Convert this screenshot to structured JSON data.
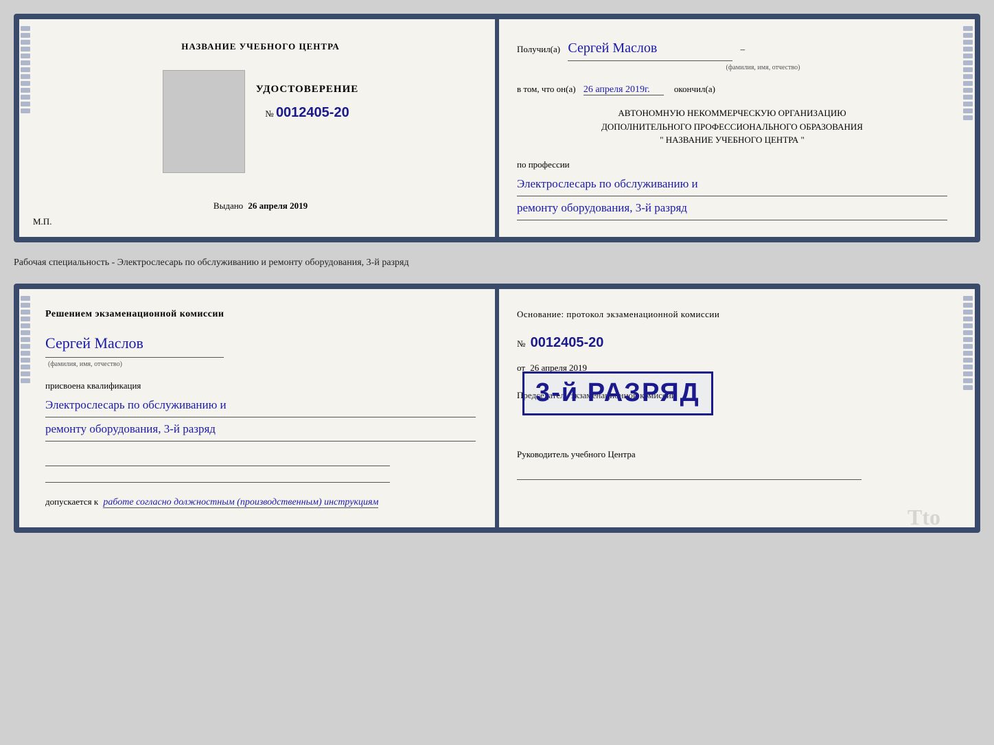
{
  "card1": {
    "left": {
      "school_name": "НАЗВАНИЕ УЧЕБНОГО ЦЕНТРА",
      "cert_label": "УДОСТОВЕРЕНИЕ",
      "cert_number_prefix": "№",
      "cert_number": "0012405-20",
      "issued_label": "Выдано",
      "issued_date": "26 апреля 2019",
      "mp_label": "М.П."
    },
    "right": {
      "received_label": "Получил(а)",
      "recipient_name": "Сергей Маслов",
      "fio_label": "(фамилия, имя, отчество)",
      "in_that_label": "в том, что он(а)",
      "completion_date": "26 апреля 2019г.",
      "finished_label": "окончил(а)",
      "org_line1": "АВТОНОМНУЮ НЕКОММЕРЧЕСКУЮ ОРГАНИЗАЦИЮ",
      "org_line2": "ДОПОЛНИТЕЛЬНОГО ПРОФЕССИОНАЛЬНОГО ОБРАЗОВАНИЯ",
      "org_line3": "\"   НАЗВАНИЕ УЧЕБНОГО ЦЕНТРА   \"",
      "profession_label": "по профессии",
      "profession_line1": "Электрослесарь по обслуживанию и",
      "profession_line2": "ремонту оборудования, 3-й разряд"
    }
  },
  "separator": {
    "text": "Рабочая специальность - Электрослесарь по обслуживанию и ремонту оборудования, 3-й разряд"
  },
  "card2": {
    "left": {
      "decision_heading": "Решением экзаменационной комиссии",
      "person_name": "Сергей Маслов",
      "fio_label": "(фамилия, имя, отчество)",
      "assigned_label": "присвоена квалификация",
      "qualification_line1": "Электрослесарь по обслуживанию и",
      "qualification_line2": "ремонту оборудования, 3-й разряд",
      "allowed_label": "допускается к",
      "allowed_text": "работе согласно должностным (производственным) инструкциям"
    },
    "right": {
      "basis_label": "Основание: протокол экзаменационной комиссии",
      "number_prefix": "№",
      "protocol_number": "0012405-20",
      "date_from_label": "от",
      "date_from_value": "26 апреля 2019",
      "chairman_label": "Председатель экзаменационной комиссии",
      "stamp_text": "3-й РАЗРЯД",
      "rukovoditel_label": "Руководитель учебного Центра"
    }
  },
  "tto": {
    "text": "Tto"
  }
}
